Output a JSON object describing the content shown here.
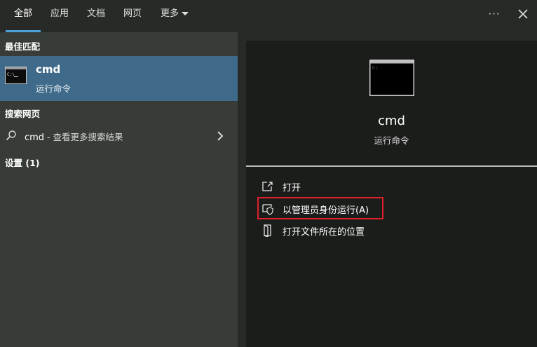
{
  "tabs": [
    {
      "label": "全部",
      "active": true
    },
    {
      "label": "应用",
      "active": false
    },
    {
      "label": "文档",
      "active": false
    },
    {
      "label": "网页",
      "active": false
    },
    {
      "label": "更多",
      "active": false
    }
  ],
  "window": {
    "more_glyph": "···",
    "close_icon": "close-icon"
  },
  "left": {
    "best_match_heading": "最佳匹配",
    "best_match": {
      "title": "cmd",
      "subtitle": "运行命令",
      "icon": "command-prompt-icon"
    },
    "web_heading": "搜索网页",
    "web_item": {
      "query": "cmd",
      "suffix": " - 查看更多搜索结果"
    },
    "settings_heading": "设置 (1)"
  },
  "right": {
    "title": "cmd",
    "subtitle": "运行命令",
    "actions": [
      {
        "label": "打开",
        "icon": "open-icon"
      },
      {
        "label": "以管理员身份运行(A)",
        "icon": "shield-icon",
        "highlighted": true
      },
      {
        "label": "打开文件所在的位置",
        "icon": "file-location-icon"
      }
    ]
  },
  "colors": {
    "accent": "#4ba0d8",
    "selected_row": "#3f6a89",
    "highlight_border": "#e0202a"
  }
}
